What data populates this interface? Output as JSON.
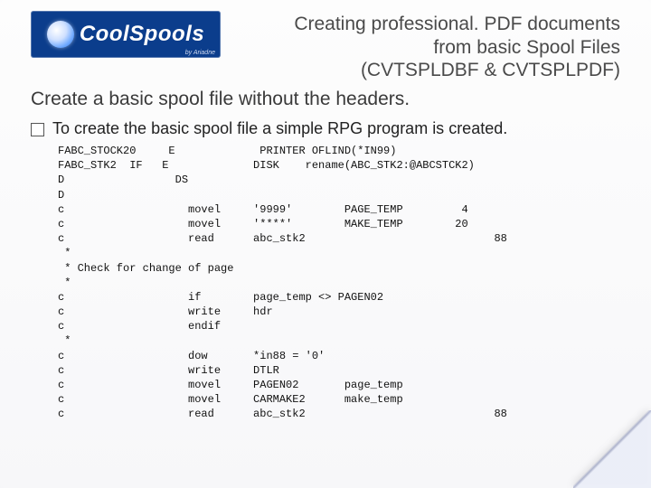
{
  "logo": {
    "brand_cool": "Cool",
    "brand_spools": "Spools",
    "byline": "by Ariadne"
  },
  "title": {
    "line1": "Creating professional. PDF documents",
    "line2": "from basic Spool Files",
    "line3": "(CVTSPLDBF & CVTSPLPDF)"
  },
  "subtitle": "Create a basic spool file without the headers.",
  "bullet": "To create the basic spool file a simple RPG program is created.",
  "code": "FABC_STOCK20     E             PRINTER OFLIND(*IN99)\nFABC_STK2  IF   E             DISK    rename(ABC_STK2:@ABCSTCK2)\nD                 DS\nD\nc                   movel     '9999'        PAGE_TEMP         4\nc                   movel     '****'        MAKE_TEMP        20\nc                   read      abc_stk2                             88\n *\n * Check for change of page\n *\nc                   if        page_temp <> PAGEN02\nc                   write     hdr\nc                   endif\n *\nc                   dow       *in88 = '0'\nc                   write     DTLR\nc                   movel     PAGEN02       page_temp\nc                   movel     CARMAKE2      make_temp\nc                   read      abc_stk2                             88"
}
